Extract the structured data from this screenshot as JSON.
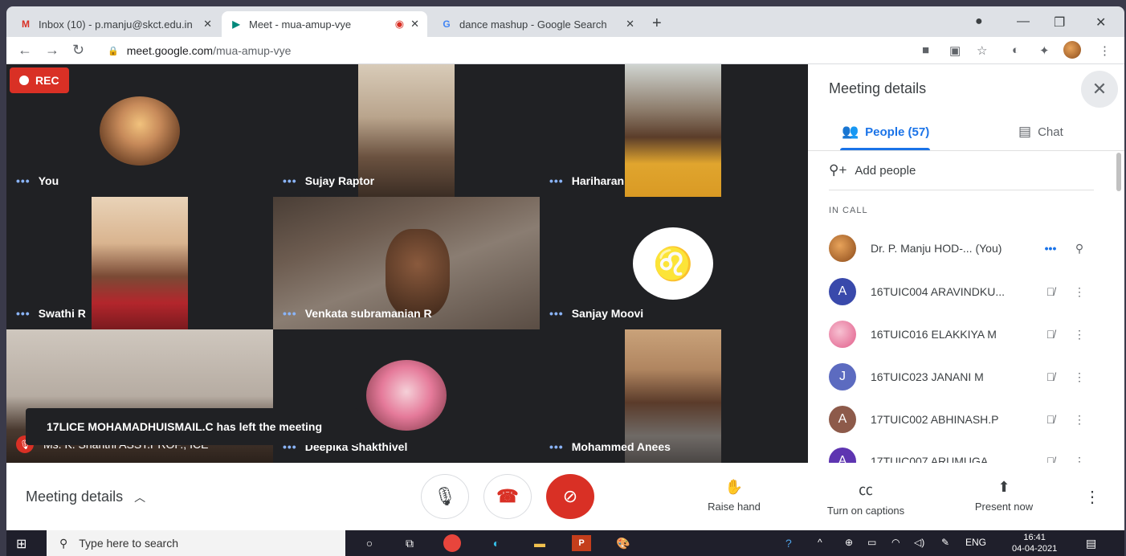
{
  "browser": {
    "tabs": [
      {
        "title": "Inbox (10) - p.manju@skct.edu.in",
        "close": "✕"
      },
      {
        "title": "Meet - mua-amup-vye",
        "close": "✕"
      },
      {
        "title": "dance mashup - Google Search",
        "close": "✕"
      }
    ],
    "new_tab": "+",
    "url_host": "meet.google.com",
    "url_path": "/mua-amup-vye"
  },
  "meet": {
    "rec_label": "REC",
    "tiles": [
      {
        "name": "You"
      },
      {
        "name": "Sujay Raptor"
      },
      {
        "name": "Hariharan"
      },
      {
        "name": "Swathi R"
      },
      {
        "name": "Venkata subramanian R"
      },
      {
        "name": "Sanjay Moovi"
      },
      {
        "name": "Ms. K. Shanthi ASST.PROF., ICE"
      },
      {
        "name": "Deepika Shakthivel"
      },
      {
        "name": "Mohammed Anees"
      }
    ],
    "dots": "•••",
    "toast": "17LICE MOHAMADHUISMAIL.C has left the meeting"
  },
  "panel": {
    "title": "Meeting details",
    "tab_people": "People (57)",
    "tab_chat": "Chat",
    "add_people": "Add people",
    "in_call": "IN CALL",
    "participants": [
      {
        "avatar": "",
        "name": "Dr. P. Manju HOD-... (You)",
        "color": "#c97a3a"
      },
      {
        "avatar": "A",
        "name": "16TUIC004 ARAVINDKU...",
        "color": "#3949ab"
      },
      {
        "avatar": "",
        "name": "16TUIC016 ELAKKIYA M",
        "color": "#ec7fa8"
      },
      {
        "avatar": "J",
        "name": "16TUIC023 JANANI M",
        "color": "#5c6bc0"
      },
      {
        "avatar": "A",
        "name": "17TUIC002 ABHINASH.P",
        "color": "#8d5a4a"
      },
      {
        "avatar": "A",
        "name": "17TUIC007 ARUMUGA...",
        "color": "#5e35b1"
      }
    ]
  },
  "bottom": {
    "meeting_details": "Meeting details",
    "raise_hand": "Raise hand",
    "captions": "Turn on captions",
    "present": "Present now"
  },
  "taskbar": {
    "search_placeholder": "Type here to search",
    "lang": "ENG",
    "time": "16:41",
    "date": "04-04-2021"
  }
}
